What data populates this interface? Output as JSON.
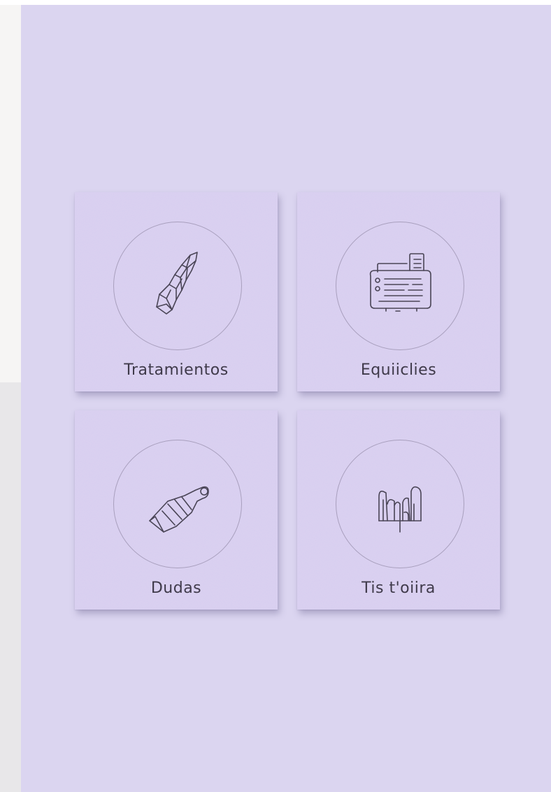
{
  "tiles": [
    {
      "label": "Tratamientos",
      "icon": "crystal-icon"
    },
    {
      "label": "Equiiclies",
      "icon": "fax-machine-icon"
    },
    {
      "label": "Dudas",
      "icon": "wrapped-bandage-icon"
    },
    {
      "label": "Tis t'oiira",
      "icon": "sculpture-icon"
    }
  ],
  "colors": {
    "panel": "#dbd5f0",
    "tile": "#d7cdef",
    "stroke": "#4a4556",
    "text": "#3f3a4a"
  }
}
